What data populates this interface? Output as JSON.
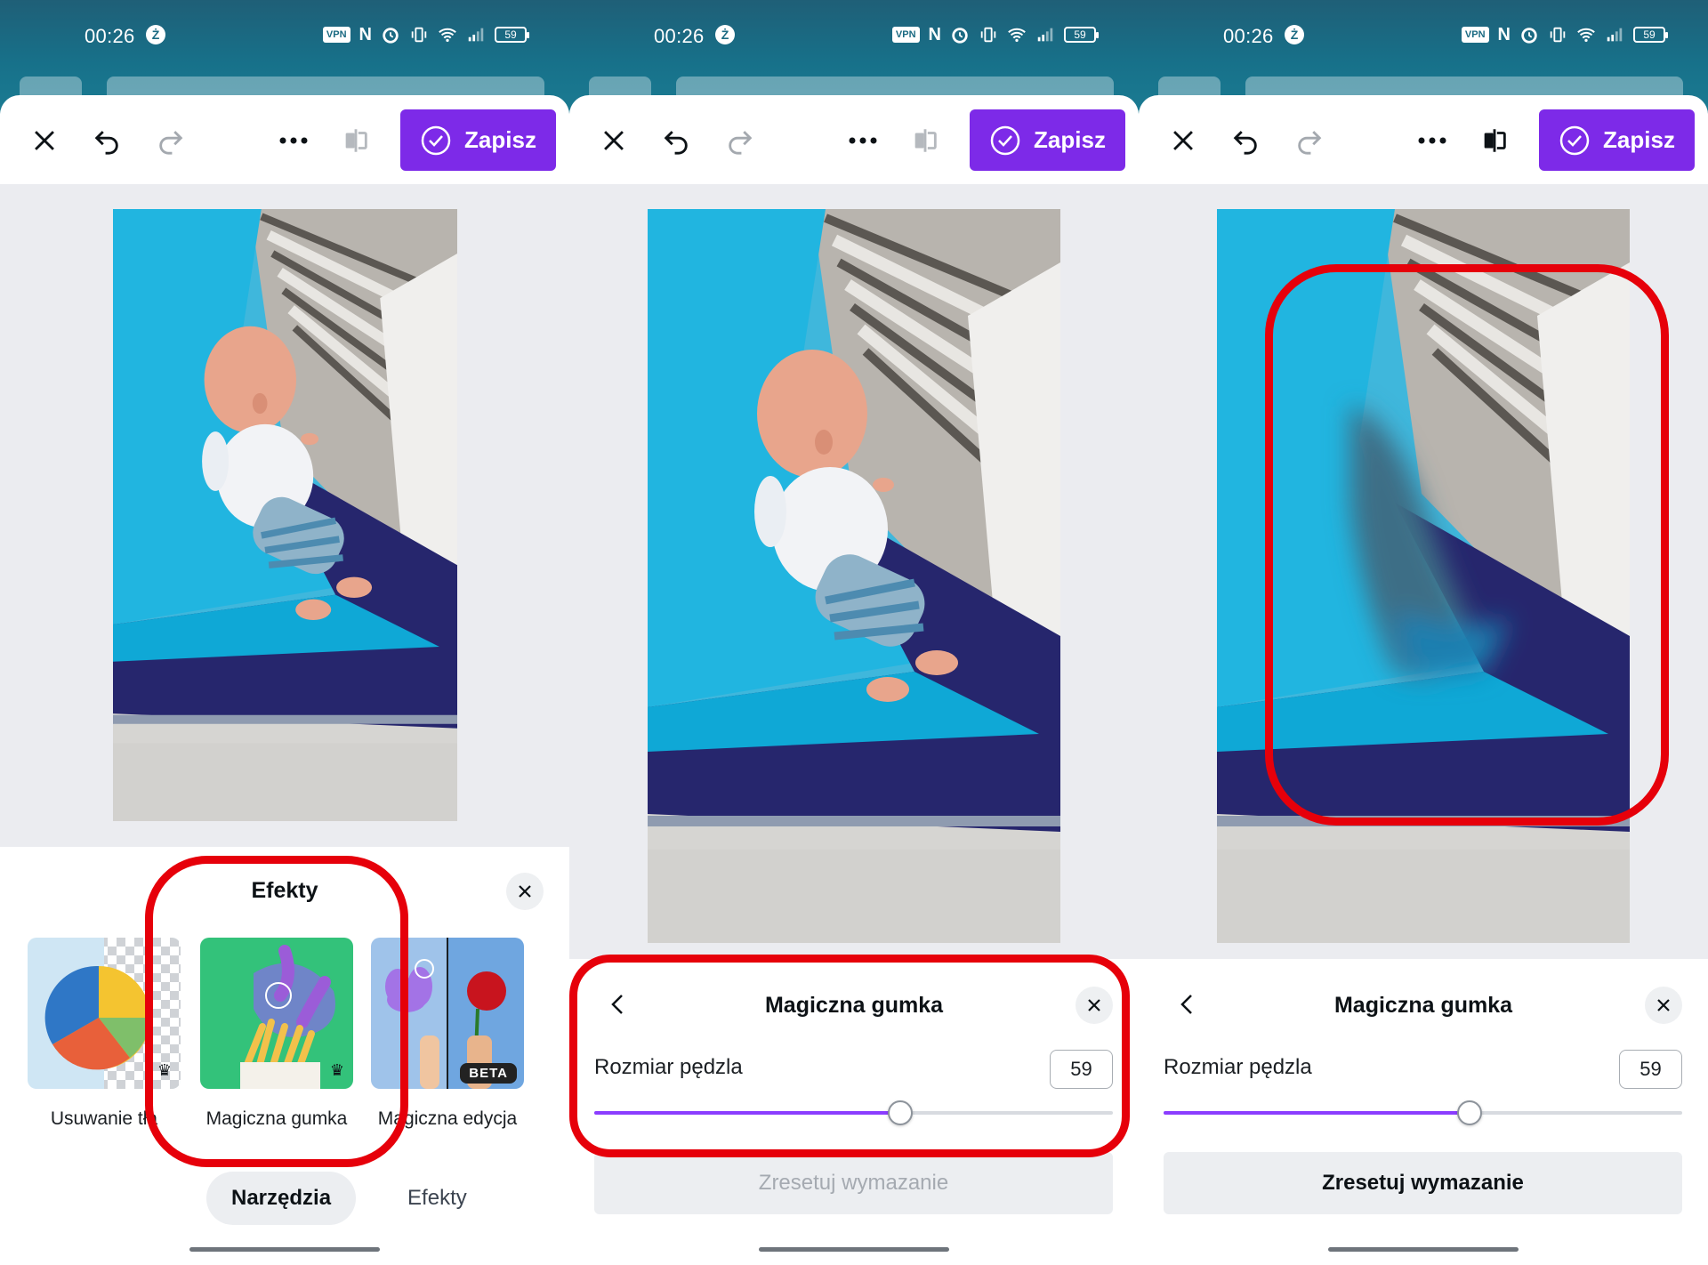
{
  "status": {
    "time": "00:26",
    "z_badge": "Ż",
    "vpn": "VPN",
    "nfc": "N",
    "battery": "59"
  },
  "toolbar": {
    "save_label": "Zapisz"
  },
  "effects_sheet": {
    "title": "Efekty",
    "tools": [
      {
        "label": "Usuwanie tła",
        "premium": true
      },
      {
        "label": "Magiczna gumka",
        "premium": true
      },
      {
        "label": "Magiczna edycja",
        "badge": "BETA"
      }
    ],
    "tabs": [
      "Narzędzia",
      "Efekty"
    ],
    "active_tab": "Narzędzia"
  },
  "eraser_sheet": {
    "title": "Magiczna gumka",
    "brush_label": "Rozmiar pędzla",
    "brush_value": "59",
    "brush_fraction": 0.59,
    "reset_label": "Zresetuj wymazanie"
  },
  "panels": [
    {
      "step": 1,
      "reset_enabled": false,
      "doll_visible": true
    },
    {
      "step": 2,
      "reset_enabled": false,
      "doll_visible": true
    },
    {
      "step": 3,
      "reset_enabled": true,
      "doll_visible": false
    }
  ],
  "colors": {
    "accent": "#7d2ae8",
    "slider": "#8b3dff",
    "annotation": "#e6000a",
    "status_bar": "#17718a"
  }
}
